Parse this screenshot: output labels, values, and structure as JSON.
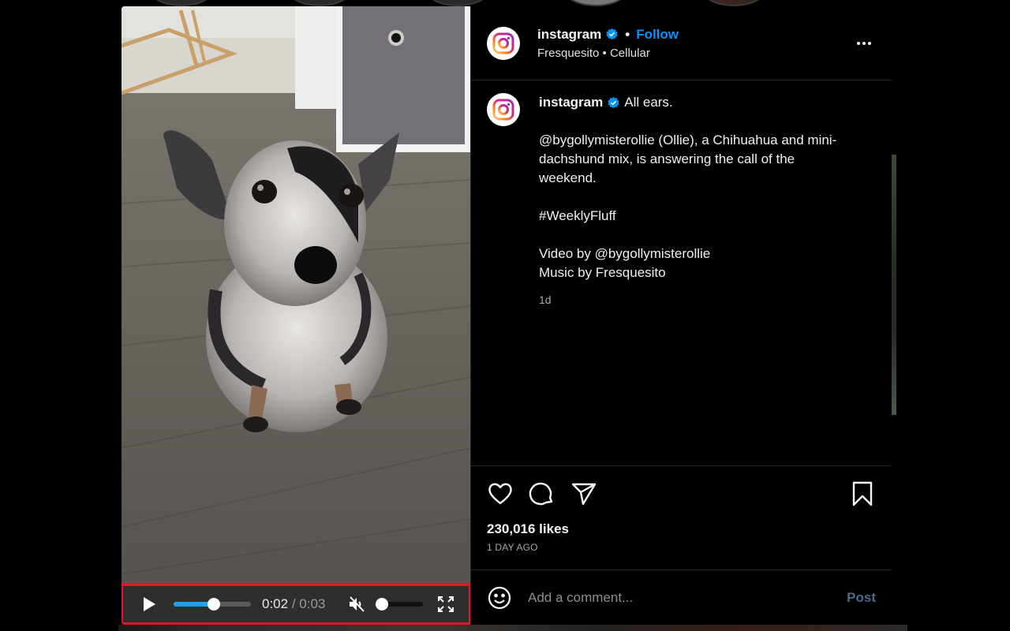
{
  "background": {
    "story_count": 5
  },
  "post": {
    "header": {
      "username": "instagram",
      "verified": true,
      "separator": "•",
      "follow_label": "Follow",
      "subline": "Fresquesito • Cellular",
      "more_icon": "more-horizontal-icon"
    },
    "caption": {
      "username": "instagram",
      "first_line": "All ears.",
      "paragraphs": [
        "@bygollymisterollie (Ollie), a Chihuahua and mini-dachshund mix, is answering the call of the weekend.",
        "#WeeklyFluff"
      ],
      "credits": [
        "Video by @bygollymisterollie",
        "Music by Fresquesito"
      ],
      "timestamp": "1d"
    },
    "actions": {
      "icons": [
        "heart-icon",
        "comment-icon",
        "share-icon",
        "bookmark-icon"
      ],
      "likes": "230,016 likes",
      "posted_ago": "1 DAY AGO"
    },
    "comment_box": {
      "emoji_icon": "emoji-icon",
      "placeholder": "Add a comment...",
      "post_label": "Post"
    },
    "video": {
      "current_time": "0:02",
      "separator": "/",
      "duration": "0:03",
      "progress_percent": 52,
      "volume_percent": 0,
      "muted": true,
      "highlight_color": "#e0162b",
      "progress_color": "#1da1f2"
    },
    "colors": {
      "follow": "#0095f6",
      "verified": "#0095f6",
      "background": "#000000"
    }
  }
}
